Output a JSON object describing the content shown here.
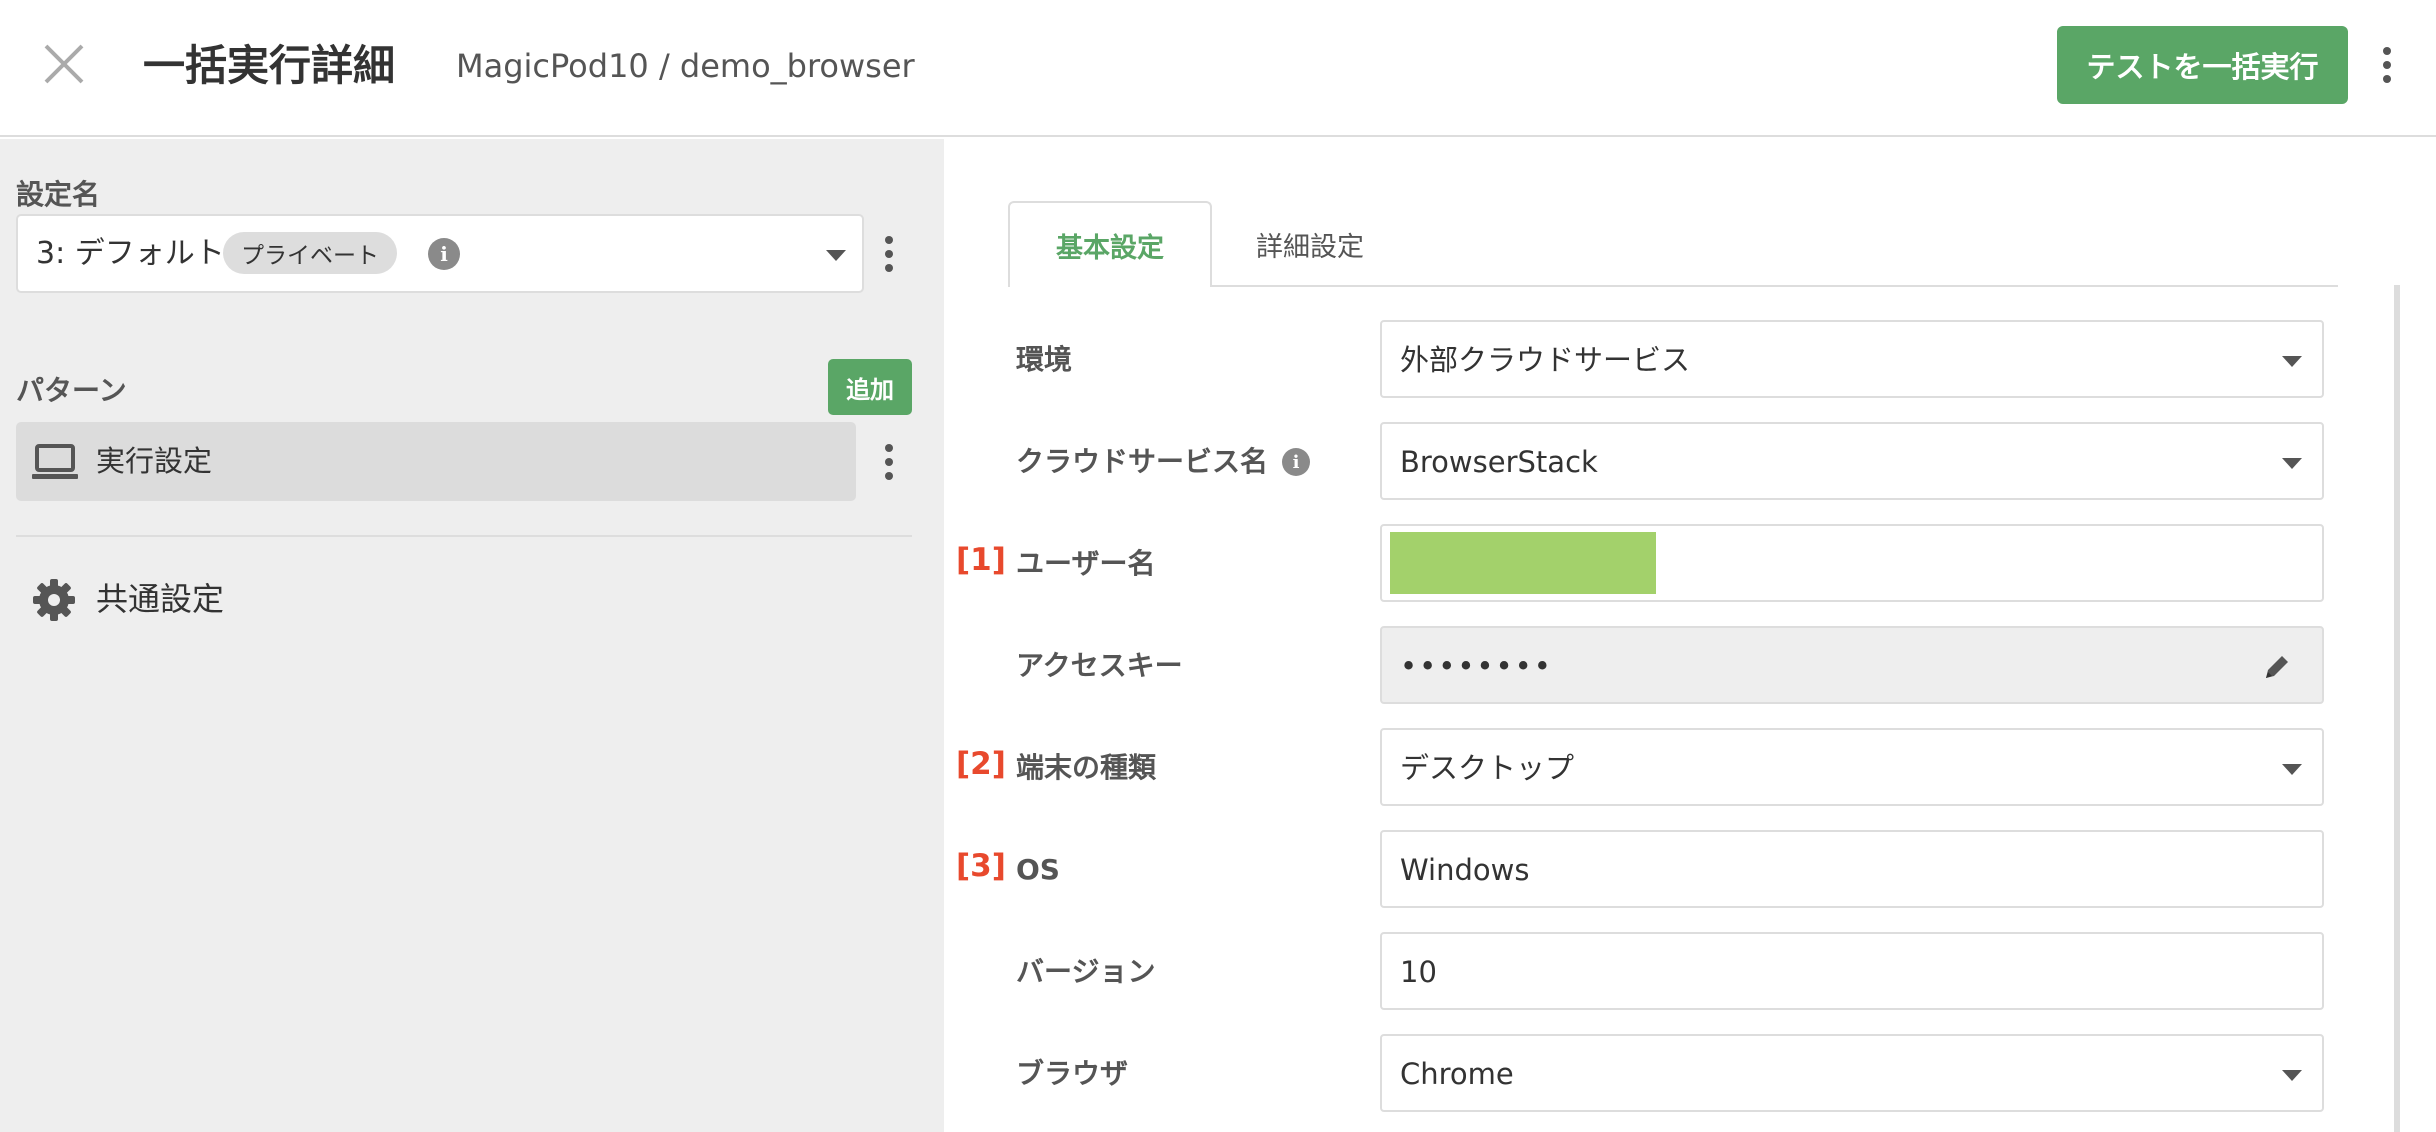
{
  "header": {
    "title": "一括実行詳細",
    "breadcrumb": "MagicPod10 / demo_browser",
    "run_button_label": "テストを一括実行"
  },
  "sidebar": {
    "setting_name_label": "設定名",
    "setting_value": "3: デフォルト",
    "setting_badge": "プライベート",
    "pattern_label": "パターン",
    "add_button_label": "追加",
    "pattern_items": [
      {
        "label": "実行設定",
        "icon": "laptop-icon"
      }
    ],
    "common_settings_label": "共通設定"
  },
  "tabs": [
    {
      "label": "基本設定",
      "active": true
    },
    {
      "label": "詳細設定",
      "active": false
    }
  ],
  "form": {
    "rows": [
      {
        "num": "",
        "label": "環境",
        "value": "外部クラウドサービス",
        "type": "select"
      },
      {
        "num": "",
        "label": "クラウドサービス名",
        "value": "BrowserStack",
        "type": "select",
        "info": true
      },
      {
        "num": "[1]",
        "label": "ユーザー名",
        "value": "",
        "type": "text",
        "redacted": true
      },
      {
        "num": "",
        "label": "アクセスキー",
        "value": "••••••••",
        "type": "password"
      },
      {
        "num": "[2]",
        "label": "端末の種類",
        "value": "デスクトップ",
        "type": "select"
      },
      {
        "num": "[3]",
        "label": "OS",
        "value": "Windows",
        "type": "text"
      },
      {
        "num": "",
        "label": "バージョン",
        "value": "10",
        "type": "text"
      },
      {
        "num": "",
        "label": "ブラウザ",
        "value": "Chrome",
        "type": "select"
      }
    ]
  },
  "colors": {
    "accent_green": "#5aa666",
    "annotation_red": "#e8492d",
    "redaction_green": "#a3d16b",
    "sidebar_bg": "#eeeeee"
  }
}
